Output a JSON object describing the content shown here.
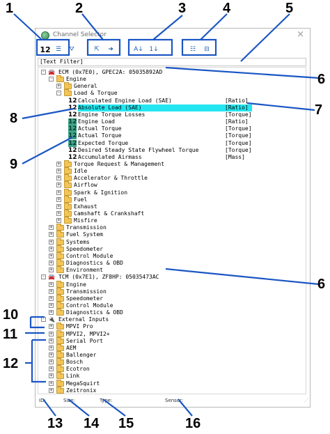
{
  "window": {
    "title": "Channel Selector",
    "close_glyph": "×"
  },
  "toolbar": {
    "buttons": [
      {
        "name": "show-sensor-icons-button",
        "glyph": "12",
        "icon": "numeric-12-icon"
      },
      {
        "name": "list-view-button",
        "glyph": "☰",
        "icon": "list-icon"
      },
      {
        "name": "filter-button",
        "glyph": "⛛",
        "icon": "funnel-icon"
      },
      {
        "name": "collapse-button",
        "glyph": "⇱",
        "icon": "arrows-collapse-icon"
      },
      {
        "name": "expand-button",
        "glyph": "➜",
        "icon": "arrow-right-icon"
      },
      {
        "name": "sort-alpha-button",
        "glyph": "A↓",
        "icon": "sort-alpha-icon"
      },
      {
        "name": "sort-numeric-button",
        "glyph": "1↓",
        "icon": "sort-numeric-icon"
      },
      {
        "name": "tree-expand-button",
        "glyph": "☷",
        "icon": "tree-expand-icon"
      },
      {
        "name": "tree-collapse-button",
        "glyph": "⊟",
        "icon": "tree-collapse-icon"
      }
    ]
  },
  "filter": {
    "text": "[Text Filter]"
  },
  "tree": [
    {
      "kind": "car",
      "indent": 0,
      "text": "ECM (0x7E0), GPEC2A: 05035892AD",
      "exp": "-"
    },
    {
      "kind": "folder",
      "indent": 1,
      "text": "Engine",
      "exp": "-"
    },
    {
      "kind": "folder",
      "indent": 2,
      "text": "General",
      "exp": "+"
    },
    {
      "kind": "folder",
      "indent": 2,
      "text": "Load & Torque",
      "exp": "-"
    },
    {
      "kind": "sensor",
      "indent": 3,
      "text": "Calculated Engine Load (SAE)",
      "unit": "[Ratio]",
      "on": false
    },
    {
      "kind": "sensor",
      "indent": 3,
      "text": "Absolute Load (SAE)",
      "unit": "[Ratio]",
      "on": false,
      "selected": true
    },
    {
      "kind": "sensor",
      "indent": 3,
      "text": "Engine Torque Losses",
      "unit": "[Torque]",
      "on": false
    },
    {
      "kind": "sensor",
      "indent": 3,
      "text": "Engine Load",
      "unit": "[Ratio]",
      "on": true
    },
    {
      "kind": "sensor",
      "indent": 3,
      "text": "Actual Torque",
      "unit": "[Torque]",
      "on": true
    },
    {
      "kind": "sensor",
      "indent": 3,
      "text": "Actual Torque",
      "unit": "[Torque]",
      "on": true
    },
    {
      "kind": "sensor",
      "indent": 3,
      "text": "Expected Torque",
      "unit": "[Torque]",
      "on": true
    },
    {
      "kind": "sensor",
      "indent": 3,
      "text": "Desired Steady State Flywheel Torque",
      "unit": "[Torque]",
      "on": false
    },
    {
      "kind": "sensor",
      "indent": 3,
      "text": "Accumulated Airmass",
      "unit": "[Mass]",
      "on": false
    },
    {
      "kind": "folder",
      "indent": 2,
      "text": "Torque Request & Management",
      "exp": "+"
    },
    {
      "kind": "folder",
      "indent": 2,
      "text": "Idle",
      "exp": "+"
    },
    {
      "kind": "folder",
      "indent": 2,
      "text": "Accelerator & Throttle",
      "exp": "+"
    },
    {
      "kind": "folder",
      "indent": 2,
      "text": "Airflow",
      "exp": "+"
    },
    {
      "kind": "folder",
      "indent": 2,
      "text": "Spark & Ignition",
      "exp": "+"
    },
    {
      "kind": "folder",
      "indent": 2,
      "text": "Fuel",
      "exp": "+"
    },
    {
      "kind": "folder",
      "indent": 2,
      "text": "Exhaust",
      "exp": "+"
    },
    {
      "kind": "folder",
      "indent": 2,
      "text": "Camshaft & Crankshaft",
      "exp": "+"
    },
    {
      "kind": "folder",
      "indent": 2,
      "text": "Misfire",
      "exp": "+"
    },
    {
      "kind": "folder",
      "indent": 1,
      "text": "Transmission",
      "exp": "+"
    },
    {
      "kind": "folder",
      "indent": 1,
      "text": "Fuel System",
      "exp": "+"
    },
    {
      "kind": "folder",
      "indent": 1,
      "text": "Systems",
      "exp": "+"
    },
    {
      "kind": "folder",
      "indent": 1,
      "text": "Speedometer",
      "exp": "+"
    },
    {
      "kind": "folder",
      "indent": 1,
      "text": "Control Module",
      "exp": "+"
    },
    {
      "kind": "folder",
      "indent": 1,
      "text": "Diagnostics & OBD",
      "exp": "+"
    },
    {
      "kind": "folder",
      "indent": 1,
      "text": "Environment",
      "exp": "+"
    },
    {
      "kind": "car",
      "indent": 0,
      "text": "TCM (0x7E1), ZF8HP: 05035473AC",
      "exp": "-"
    },
    {
      "kind": "folder",
      "indent": 1,
      "text": "Engine",
      "exp": "+"
    },
    {
      "kind": "folder",
      "indent": 1,
      "text": "Transmission",
      "exp": "+"
    },
    {
      "kind": "folder",
      "indent": 1,
      "text": "Speedometer",
      "exp": "+"
    },
    {
      "kind": "folder",
      "indent": 1,
      "text": "Control Module",
      "exp": "+"
    },
    {
      "kind": "folder",
      "indent": 1,
      "text": "Diagnostics & OBD",
      "exp": "+"
    },
    {
      "kind": "plug",
      "indent": 0,
      "text": "External Inputs",
      "exp": "-"
    },
    {
      "kind": "folder",
      "indent": 1,
      "text": "MPVI Pro",
      "exp": "+"
    },
    {
      "kind": "folder",
      "indent": 1,
      "text": "MPVI2, MPVI2+",
      "exp": "+"
    },
    {
      "kind": "folder",
      "indent": 1,
      "text": "Serial Port",
      "exp": "+"
    },
    {
      "kind": "folder",
      "indent": 1,
      "text": "AEM",
      "exp": "+"
    },
    {
      "kind": "folder",
      "indent": 1,
      "text": "Ballenger",
      "exp": "+"
    },
    {
      "kind": "folder",
      "indent": 1,
      "text": "Bosch",
      "exp": "+"
    },
    {
      "kind": "folder",
      "indent": 1,
      "text": "Ecotron",
      "exp": "+"
    },
    {
      "kind": "folder",
      "indent": 1,
      "text": "Link",
      "exp": "+"
    },
    {
      "kind": "folder",
      "indent": 1,
      "text": "MegaSquirt",
      "exp": "+"
    },
    {
      "kind": "folder",
      "indent": 1,
      "text": "Zeitronix",
      "exp": "+"
    }
  ],
  "status": {
    "id": "ID:",
    "size": "Size:",
    "type": "Type:",
    "sensor": "Sensor:"
  },
  "callouts": [
    "1",
    "2",
    "3",
    "4",
    "5",
    "6",
    "7",
    "8",
    "9",
    "6",
    "10",
    "11",
    "12",
    "13",
    "14",
    "15",
    "16"
  ],
  "colors": {
    "selection": "#23e6f0",
    "sensor_enabled": "#3ea48a",
    "folder": "#f2c45a",
    "callout_line": "#1a56c4"
  }
}
